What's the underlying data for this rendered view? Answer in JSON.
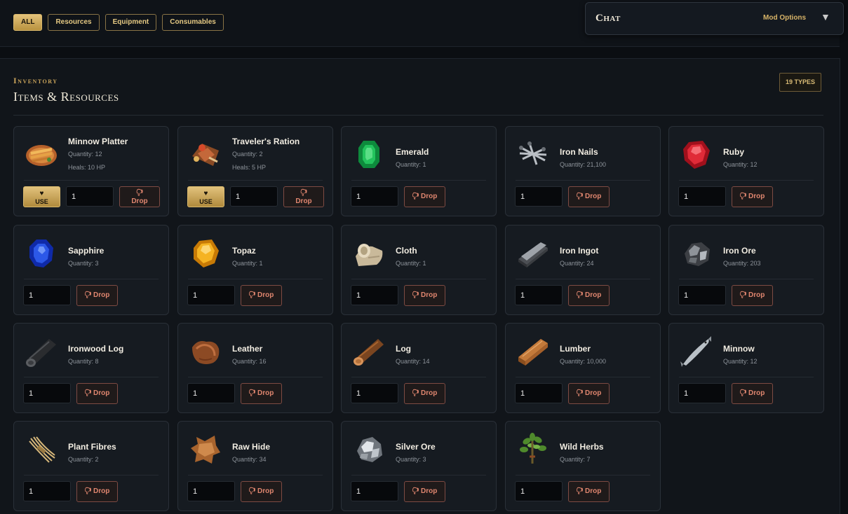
{
  "filters": [
    {
      "label": "ALL",
      "active": true
    },
    {
      "label": "Resources",
      "active": false
    },
    {
      "label": "Equipment",
      "active": false
    },
    {
      "label": "Consumables",
      "active": false
    }
  ],
  "chat": {
    "title": "Chat",
    "mod_options": "Mod Options",
    "toggle": "▼"
  },
  "inventory": {
    "supertitle": "Inventory",
    "title": "Items & Resources",
    "types_badge": "19 TYPES"
  },
  "actions": {
    "use": "USE",
    "drop": "Drop",
    "drop_icon": "🖓"
  },
  "items": [
    {
      "name": "Minnow Platter",
      "quantity": "Quantity: 12",
      "heals": "Heals: 10 HP",
      "input": "1",
      "icon": "minnow-platter-icon",
      "usable": true
    },
    {
      "name": "Traveler's Ration",
      "quantity": "Quantity: 2",
      "heals": "Heals: 5 HP",
      "input": "1",
      "icon": "travelers-ration-icon",
      "usable": true
    },
    {
      "name": "Emerald",
      "quantity": "Quantity: 1",
      "input": "1",
      "icon": "emerald-icon"
    },
    {
      "name": "Iron Nails",
      "quantity": "Quantity: 21,100",
      "input": "1",
      "icon": "iron-nails-icon"
    },
    {
      "name": "Ruby",
      "quantity": "Quantity: 12",
      "input": "1",
      "icon": "ruby-icon"
    },
    {
      "name": "Sapphire",
      "quantity": "Quantity: 3",
      "input": "1",
      "icon": "sapphire-icon"
    },
    {
      "name": "Topaz",
      "quantity": "Quantity: 1",
      "input": "1",
      "icon": "topaz-icon"
    },
    {
      "name": "Cloth",
      "quantity": "Quantity: 1",
      "input": "1",
      "icon": "cloth-icon"
    },
    {
      "name": "Iron Ingot",
      "quantity": "Quantity: 24",
      "input": "1",
      "icon": "iron-ingot-icon"
    },
    {
      "name": "Iron Ore",
      "quantity": "Quantity: 203",
      "input": "1",
      "icon": "iron-ore-icon"
    },
    {
      "name": "Ironwood Log",
      "quantity": "Quantity: 8",
      "input": "1",
      "icon": "ironwood-log-icon"
    },
    {
      "name": "Leather",
      "quantity": "Quantity: 16",
      "input": "1",
      "icon": "leather-icon"
    },
    {
      "name": "Log",
      "quantity": "Quantity: 14",
      "input": "1",
      "icon": "log-icon"
    },
    {
      "name": "Lumber",
      "quantity": "Quantity: 10,000",
      "input": "1",
      "icon": "lumber-icon"
    },
    {
      "name": "Minnow",
      "quantity": "Quantity: 12",
      "input": "1",
      "icon": "minnow-icon"
    },
    {
      "name": "Plant Fibres",
      "quantity": "Quantity: 2",
      "input": "1",
      "icon": "plant-fibres-icon"
    },
    {
      "name": "Raw Hide",
      "quantity": "Quantity: 34",
      "input": "1",
      "icon": "raw-hide-icon"
    },
    {
      "name": "Silver Ore",
      "quantity": "Quantity: 3",
      "input": "1",
      "icon": "silver-ore-icon"
    },
    {
      "name": "Wild Herbs",
      "quantity": "Quantity: 7",
      "input": "1",
      "icon": "wild-herbs-icon"
    }
  ]
}
